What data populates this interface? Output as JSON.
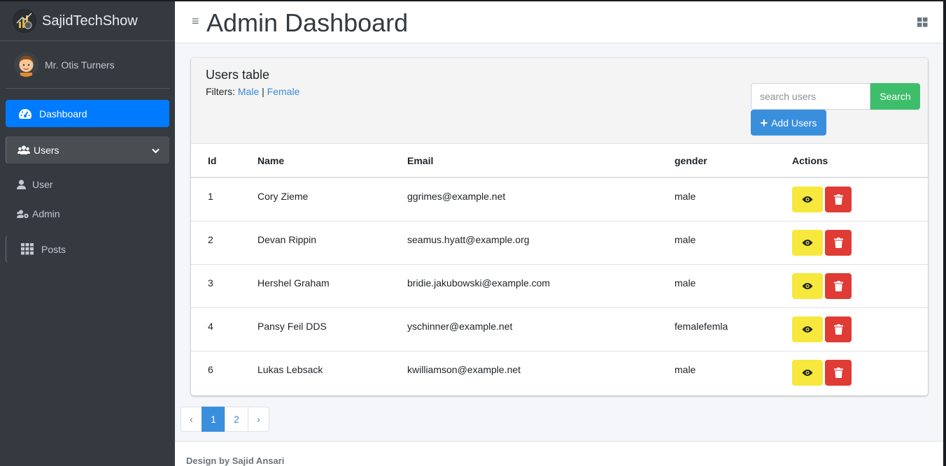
{
  "brand": {
    "name": "SajidTechShow"
  },
  "user": {
    "name": "Mr. Otis Turners"
  },
  "sidebar": {
    "items": [
      {
        "label": "Dashboard",
        "icon": "tachometer-icon",
        "active": true
      },
      {
        "label": "Users",
        "icon": "users-icon",
        "open": true
      },
      {
        "label": "User",
        "icon": "user-icon"
      },
      {
        "label": "Admin",
        "icon": "users-cog-icon"
      },
      {
        "label": "Posts",
        "icon": "th-icon"
      }
    ]
  },
  "header": {
    "menu_glyph": "≡",
    "title": "Admin Dashboard"
  },
  "card": {
    "title": "Users table",
    "filters_label": "Filters:",
    "filter_male": "Male",
    "filter_separator": "|",
    "filter_female": "Female",
    "search_placeholder": "search users",
    "search_button": "Search",
    "add_button": "Add Users",
    "add_glyph": "+"
  },
  "table": {
    "columns": [
      "Id",
      "Name",
      "Email",
      "gender",
      "Actions"
    ],
    "rows": [
      {
        "id": "1",
        "name": "Cory Zieme",
        "email": "ggrimes@example.net",
        "gender": "male"
      },
      {
        "id": "2",
        "name": "Devan Rippin",
        "email": "seamus.hyatt@example.org",
        "gender": "male"
      },
      {
        "id": "3",
        "name": "Hershel Graham",
        "email": "bridie.jakubowski@example.com",
        "gender": "male"
      },
      {
        "id": "4",
        "name": "Pansy Feil DDS",
        "email": "yschinner@example.net",
        "gender": "femalefemla"
      },
      {
        "id": "6",
        "name": "Lukas Lebsack",
        "email": "kwilliamson@example.net",
        "gender": "male"
      }
    ]
  },
  "pagination": {
    "prev": "‹",
    "pages": [
      "1",
      "2"
    ],
    "current": "1",
    "next": "›"
  },
  "footer": {
    "text": "Design by Sajid Ansari"
  },
  "colors": {
    "sidebar_bg": "#343a40",
    "primary": "#007bff",
    "success": "#3ebe6b",
    "warning": "#f6e83c",
    "danger": "#e03b35"
  }
}
